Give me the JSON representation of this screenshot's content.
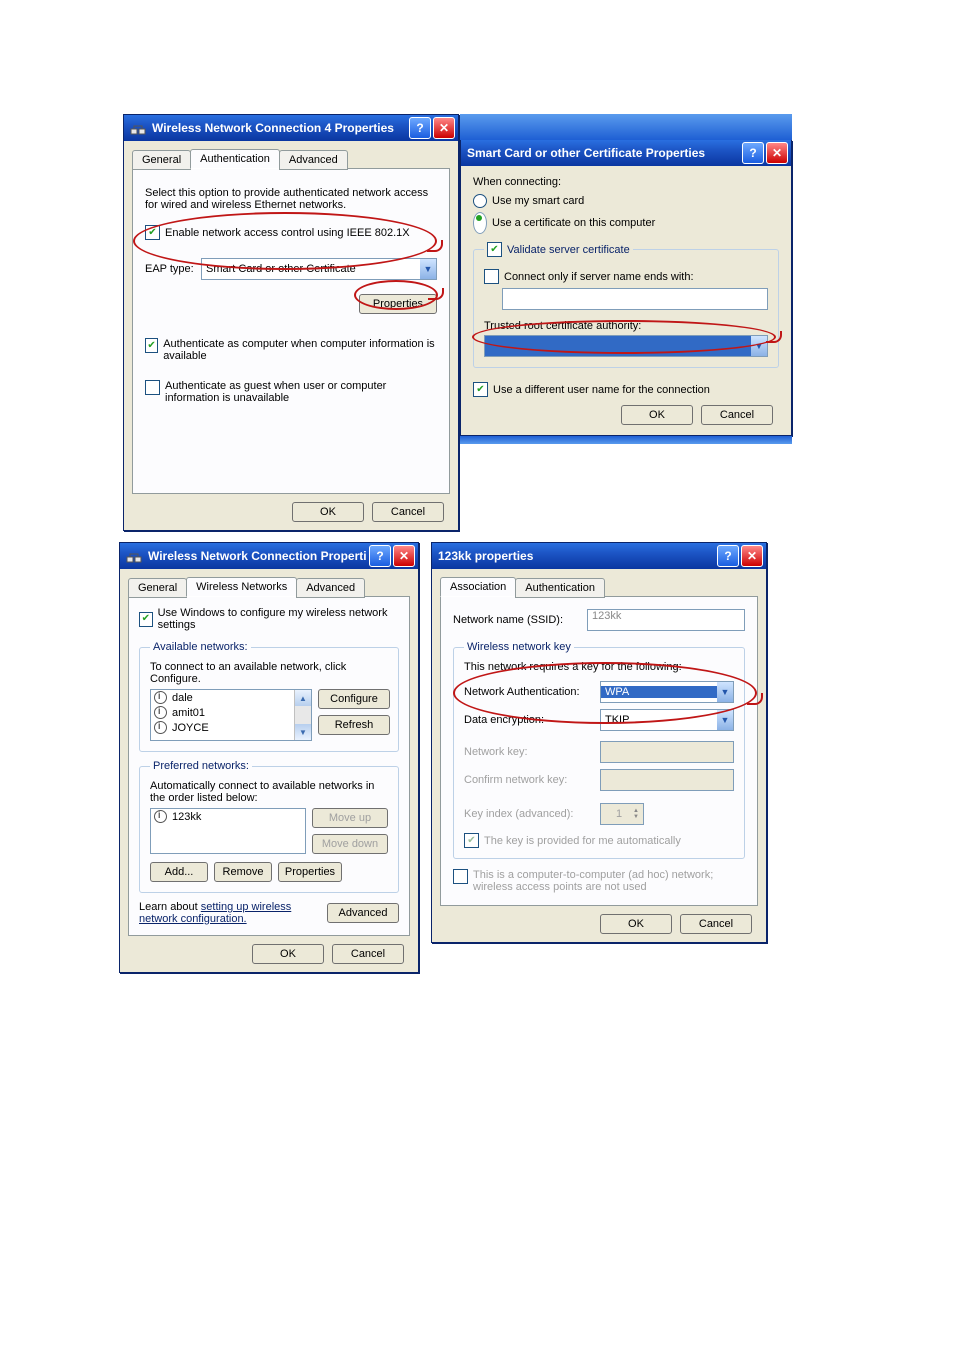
{
  "dlg1": {
    "title": "Wireless Network Connection 4 Properties",
    "tabs": [
      "General",
      "Authentication",
      "Advanced"
    ],
    "active_tab": 1,
    "intro": "Select this option to provide authenticated network access for wired and wireless Ethernet networks.",
    "enable_8021x_label": "Enable network access control using IEEE 802.1X",
    "enable_8021x_checked": true,
    "eap_type_label": "EAP type:",
    "eap_type_value": "Smart Card or other Certificate",
    "properties_btn": "Properties",
    "auth_as_computer_label": "Authenticate as computer when computer information is available",
    "auth_as_computer_checked": true,
    "auth_as_guest_label": "Authenticate as guest when user or computer information is unavailable",
    "auth_as_guest_checked": false,
    "ok": "OK",
    "cancel": "Cancel"
  },
  "dlg2": {
    "title": "Smart Card or other Certificate Properties",
    "when_connecting": "When connecting:",
    "use_smart_card": "Use my smart card",
    "use_cert": "Use a certificate on this computer",
    "cert_selected": true,
    "validate_label": "Validate server certificate",
    "validate_checked": true,
    "connect_only_if_label": "Connect only if server name ends with:",
    "connect_only_if_checked": false,
    "server_name_value": "",
    "trusted_root_label": "Trusted root certificate authority:",
    "trusted_root_value": "",
    "diff_user_label": "Use a different user name for the connection",
    "diff_user_checked": true,
    "ok": "OK",
    "cancel": "Cancel"
  },
  "dlg3": {
    "title": "Wireless Network Connection Properties",
    "tabs": [
      "General",
      "Wireless Networks",
      "Advanced"
    ],
    "active_tab": 1,
    "use_windows_label": "Use Windows to configure my wireless network settings",
    "use_windows_checked": true,
    "available_legend": "Available networks:",
    "available_caption": "To connect to an available network, click Configure.",
    "available_items": [
      "dale",
      "amit01",
      "JOYCE"
    ],
    "configure_btn": "Configure",
    "refresh_btn": "Refresh",
    "preferred_legend": "Preferred networks:",
    "preferred_caption": "Automatically connect to available networks in the order listed below:",
    "preferred_items": [
      "123kk"
    ],
    "moveup_btn": "Move up",
    "movedown_btn": "Move down",
    "add_btn": "Add...",
    "remove_btn": "Remove",
    "properties_btn": "Properties",
    "learn_prefix": "Learn about ",
    "learn_link": "setting up wireless network configuration.",
    "advanced_btn": "Advanced",
    "ok": "OK",
    "cancel": "Cancel"
  },
  "dlg4": {
    "title": "123kk properties",
    "tabs": [
      "Association",
      "Authentication"
    ],
    "active_tab": 0,
    "ssid_label": "Network name (SSID):",
    "ssid_value": "123kk",
    "wnk_legend": "Wireless network key",
    "wnk_caption": "This network requires a key for the following:",
    "net_auth_label": "Network Authentication:",
    "net_auth_value": "WPA",
    "data_enc_label": "Data encryption:",
    "data_enc_value": "TKIP",
    "network_key_label": "Network key:",
    "confirm_key_label": "Confirm network key:",
    "key_index_label": "Key index (advanced):",
    "key_index_value": "1",
    "key_auto_label": "The key is provided for me automatically",
    "key_auto_checked": true,
    "adhoc_label": "This is a computer-to-computer (ad hoc) network; wireless access points are not used",
    "adhoc_checked": false,
    "ok": "OK",
    "cancel": "Cancel"
  }
}
